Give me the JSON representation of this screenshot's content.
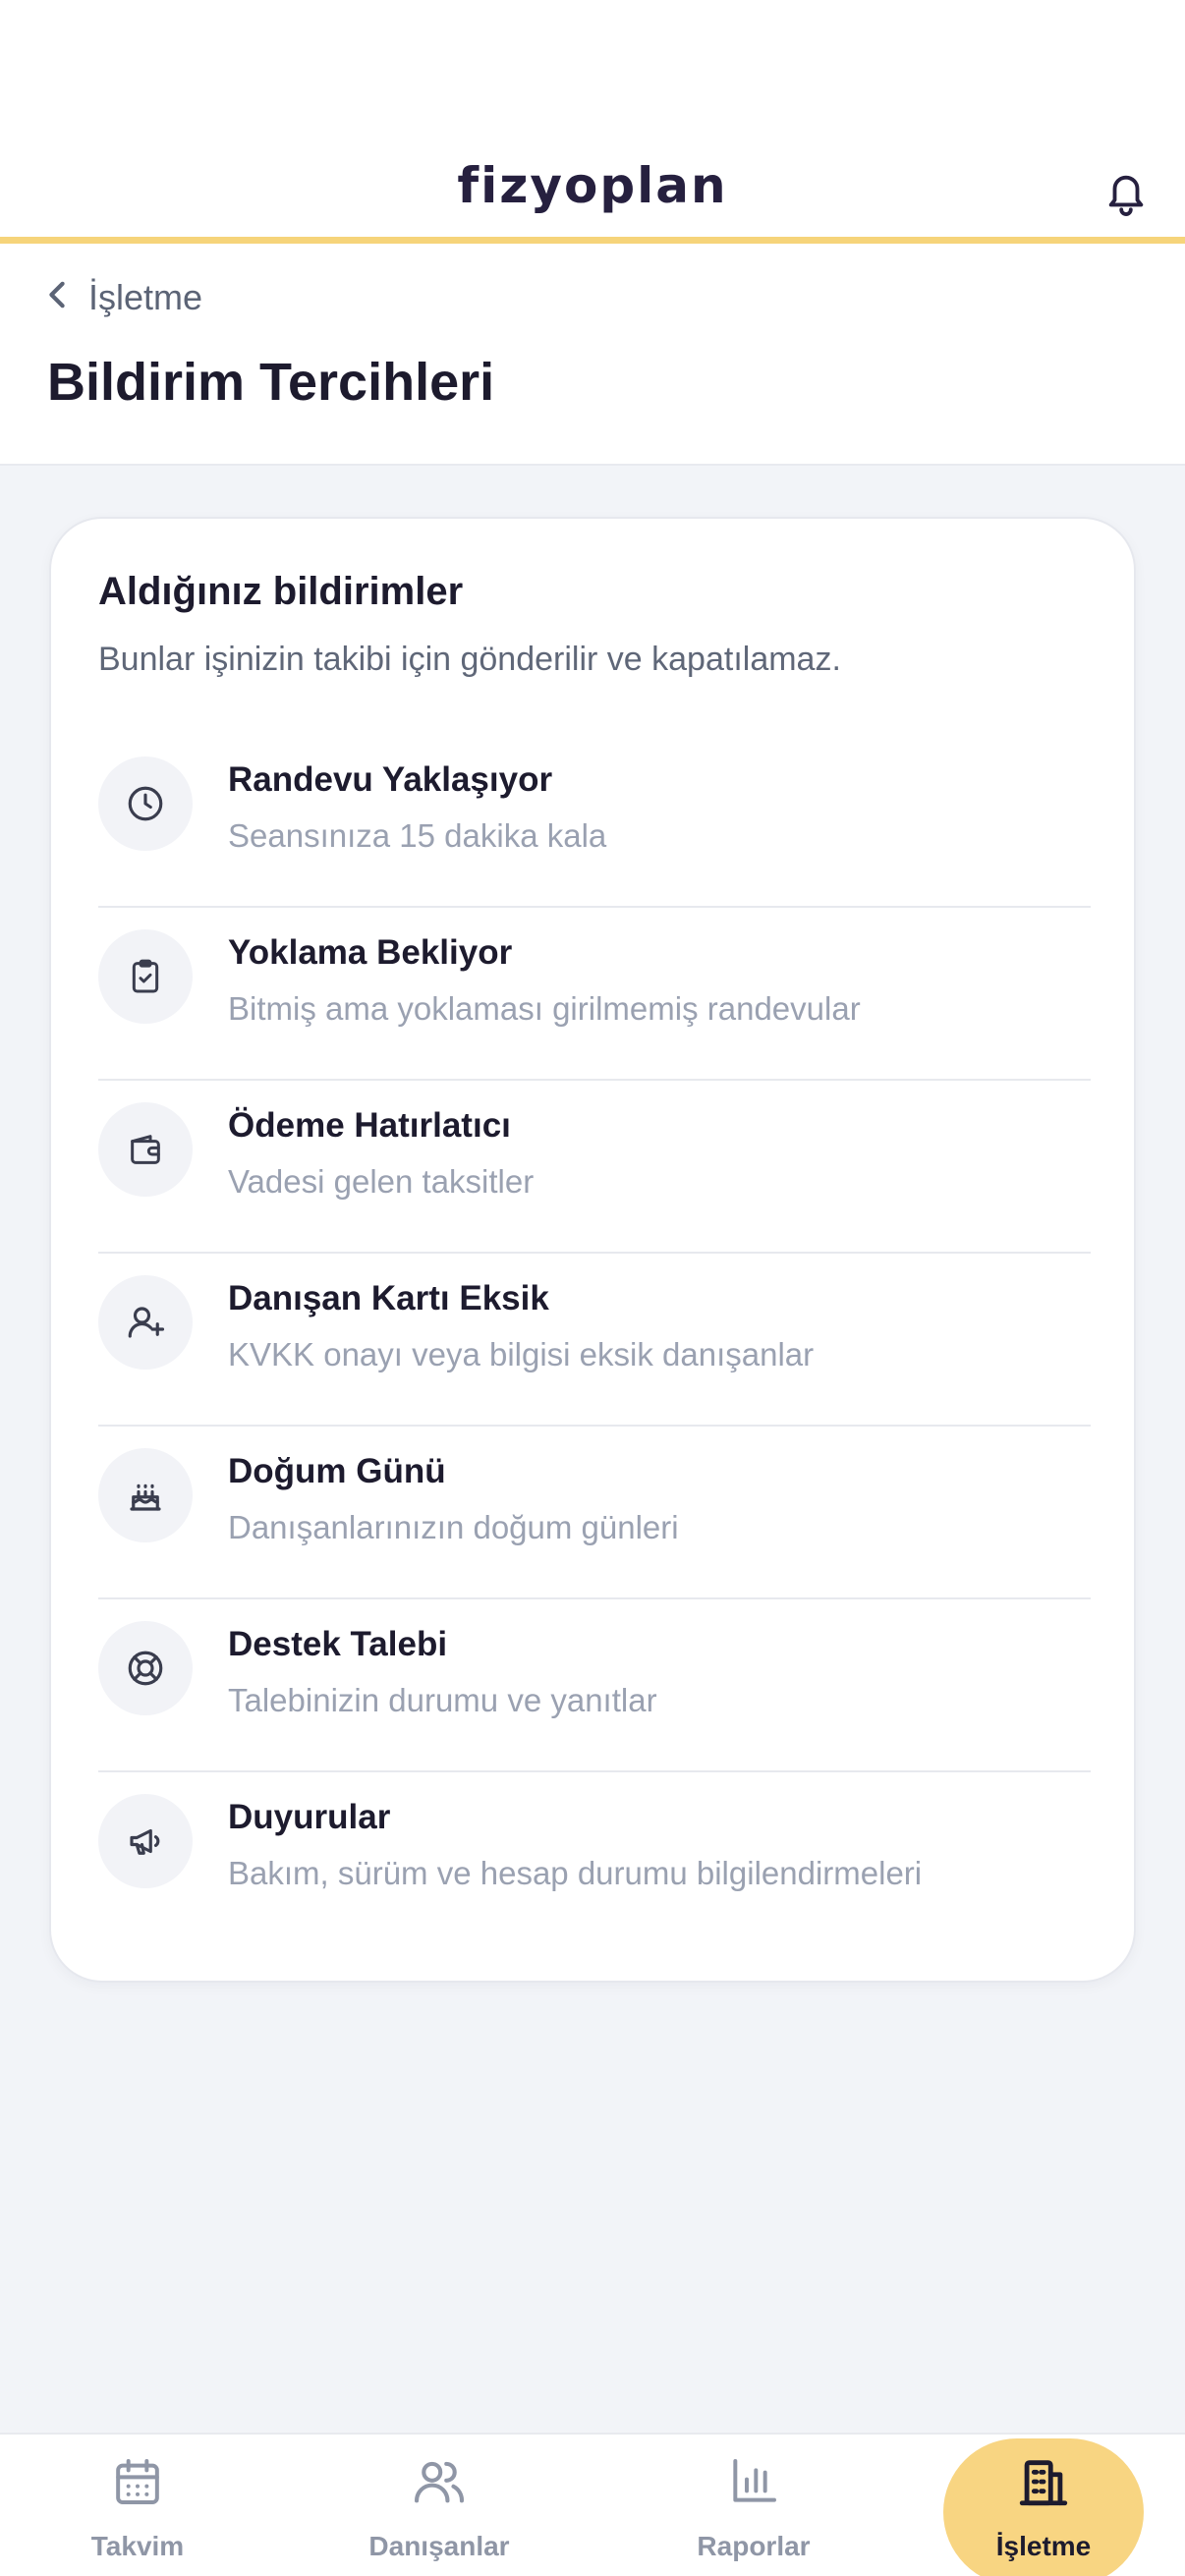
{
  "header": {
    "logo": "fizyoplan"
  },
  "nav": {
    "back_label": "İşletme",
    "page_title": "Bildirim Tercihleri"
  },
  "card": {
    "title": "Aldığınız bildirimler",
    "subtitle": "Bunlar işinizin takibi için gönderilir ve kapatılamaz.",
    "items": [
      {
        "icon": "clock-icon",
        "title": "Randevu Yaklaşıyor",
        "description": "Seansınıza 15 dakika kala"
      },
      {
        "icon": "clipboard-check-icon",
        "title": "Yoklama Bekliyor",
        "description": "Bitmiş ama yoklaması girilmemiş randevular"
      },
      {
        "icon": "wallet-icon",
        "title": "Ödeme Hatırlatıcı",
        "description": "Vadesi gelen taksitler"
      },
      {
        "icon": "user-plus-icon",
        "title": "Danışan Kartı Eksik",
        "description": "KVKK onayı veya bilgisi eksik danışanlar"
      },
      {
        "icon": "cake-icon",
        "title": "Doğum Günü",
        "description": "Danışanlarınızın doğum günleri"
      },
      {
        "icon": "lifebuoy-icon",
        "title": "Destek Talebi",
        "description": "Talebinizin durumu ve yanıtlar"
      },
      {
        "icon": "megaphone-icon",
        "title": "Duyurular",
        "description": "Bakım, sürüm ve hesap durumu bilgilendirmeleri"
      }
    ]
  },
  "bottom_nav": {
    "items": [
      {
        "icon": "calendar-icon",
        "label": "Takvim",
        "active": false
      },
      {
        "icon": "users-icon",
        "label": "Danışanlar",
        "active": false
      },
      {
        "icon": "bar-chart-icon",
        "label": "Raporlar",
        "active": false
      },
      {
        "icon": "building-icon",
        "label": "İşletme",
        "active": true
      }
    ]
  },
  "colors": {
    "accent": "#f8d582",
    "header_border": "#f6d47a",
    "background": "#f2f4f8",
    "text_primary": "#1d1b2e",
    "text_muted": "#9aa1b1"
  }
}
